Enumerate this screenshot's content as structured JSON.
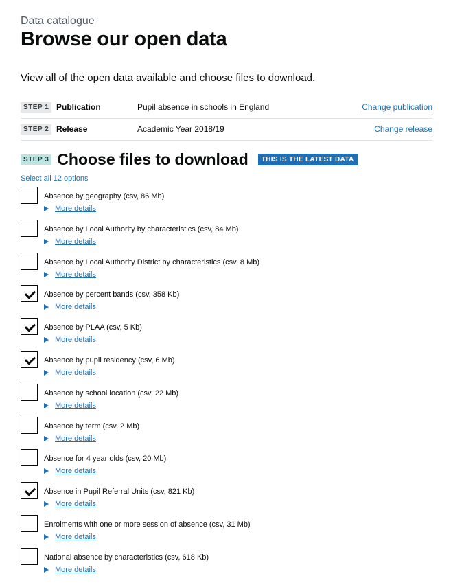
{
  "header": {
    "caption": "Data catalogue",
    "title": "Browse our open data",
    "intro": "View all of the open data available and choose files to download."
  },
  "steps": [
    {
      "tag": "STEP 1",
      "label": "Publication",
      "value": "Pupil absence in schools in England",
      "link": "Change publication"
    },
    {
      "tag": "STEP 2",
      "label": "Release",
      "value": "Academic Year 2018/19",
      "link": "Change release"
    }
  ],
  "step3": {
    "tag": "STEP 3",
    "heading": "Choose files to download",
    "latest_tag": "THIS IS THE LATEST DATA",
    "select_all": "Select all 12 options"
  },
  "details_label": "More details",
  "files": [
    {
      "label": "Absence by geography (csv, 86 Mb)",
      "checked": false
    },
    {
      "label": "Absence by Local Authority by characteristics (csv, 84 Mb)",
      "checked": false
    },
    {
      "label": "Absence by Local Authority District by characteristics (csv, 8 Mb)",
      "checked": false
    },
    {
      "label": "Absence by percent bands (csv, 358 Kb)",
      "checked": true
    },
    {
      "label": "Absence by PLAA (csv, 5 Kb)",
      "checked": true
    },
    {
      "label": "Absence by pupil residency (csv, 6 Mb)",
      "checked": true
    },
    {
      "label": "Absence by school location (csv, 22 Mb)",
      "checked": false
    },
    {
      "label": "Absence by term (csv, 2 Mb)",
      "checked": false
    },
    {
      "label": "Absence for 4 year olds (csv, 20 Mb)",
      "checked": false
    },
    {
      "label": "Absence in Pupil Referral Units (csv, 821 Kb)",
      "checked": true
    },
    {
      "label": "Enrolments with one or more session of absence (csv, 31 Mb)",
      "checked": false
    },
    {
      "label": "National absence by characteristics (csv, 618 Kb)",
      "checked": false
    }
  ],
  "colors": {
    "link": "#1d70b8",
    "text": "#0b0c0c",
    "step3_tag": "#bfe3e0",
    "latest_tag": "#1d70b8"
  }
}
